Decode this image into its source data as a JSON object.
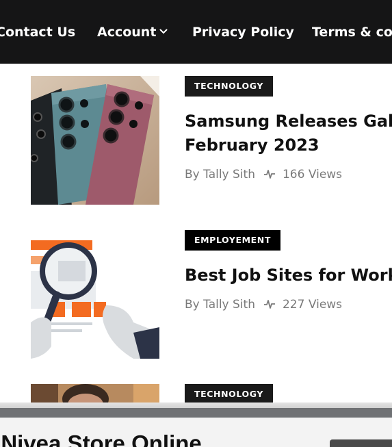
{
  "nav": {
    "items": [
      {
        "label": "Contact Us"
      },
      {
        "label": "Account"
      },
      {
        "label": "Privacy Policy"
      },
      {
        "label": "Terms & cor"
      }
    ]
  },
  "posts": [
    {
      "category": "TECHNOLOGY",
      "category_color": "#1a1a1a",
      "title_line1": "Samsung Releases Gala",
      "title_line2": "February 2023",
      "author": "By Tally Sith",
      "views": "166 Views",
      "thumbnail_icon": "phones-image"
    },
    {
      "category": "EMPLOYEMENT",
      "category_color": "#000000",
      "title_line1": "Best Job Sites for Work C",
      "author": "By Tally Sith",
      "views": "227 Views",
      "thumbnail_icon": "magnifier-job-image"
    },
    {
      "category": "TECHNOLOGY",
      "category_color": "#1a1a1a",
      "thumbnail_icon": "person-photo"
    }
  ],
  "bottom_banner": {
    "title": "n Nivea Store Online"
  },
  "colors": {
    "nav_bg": "#151516",
    "meta_text": "#7a7a7a",
    "accent_orange": "#f36b21"
  }
}
